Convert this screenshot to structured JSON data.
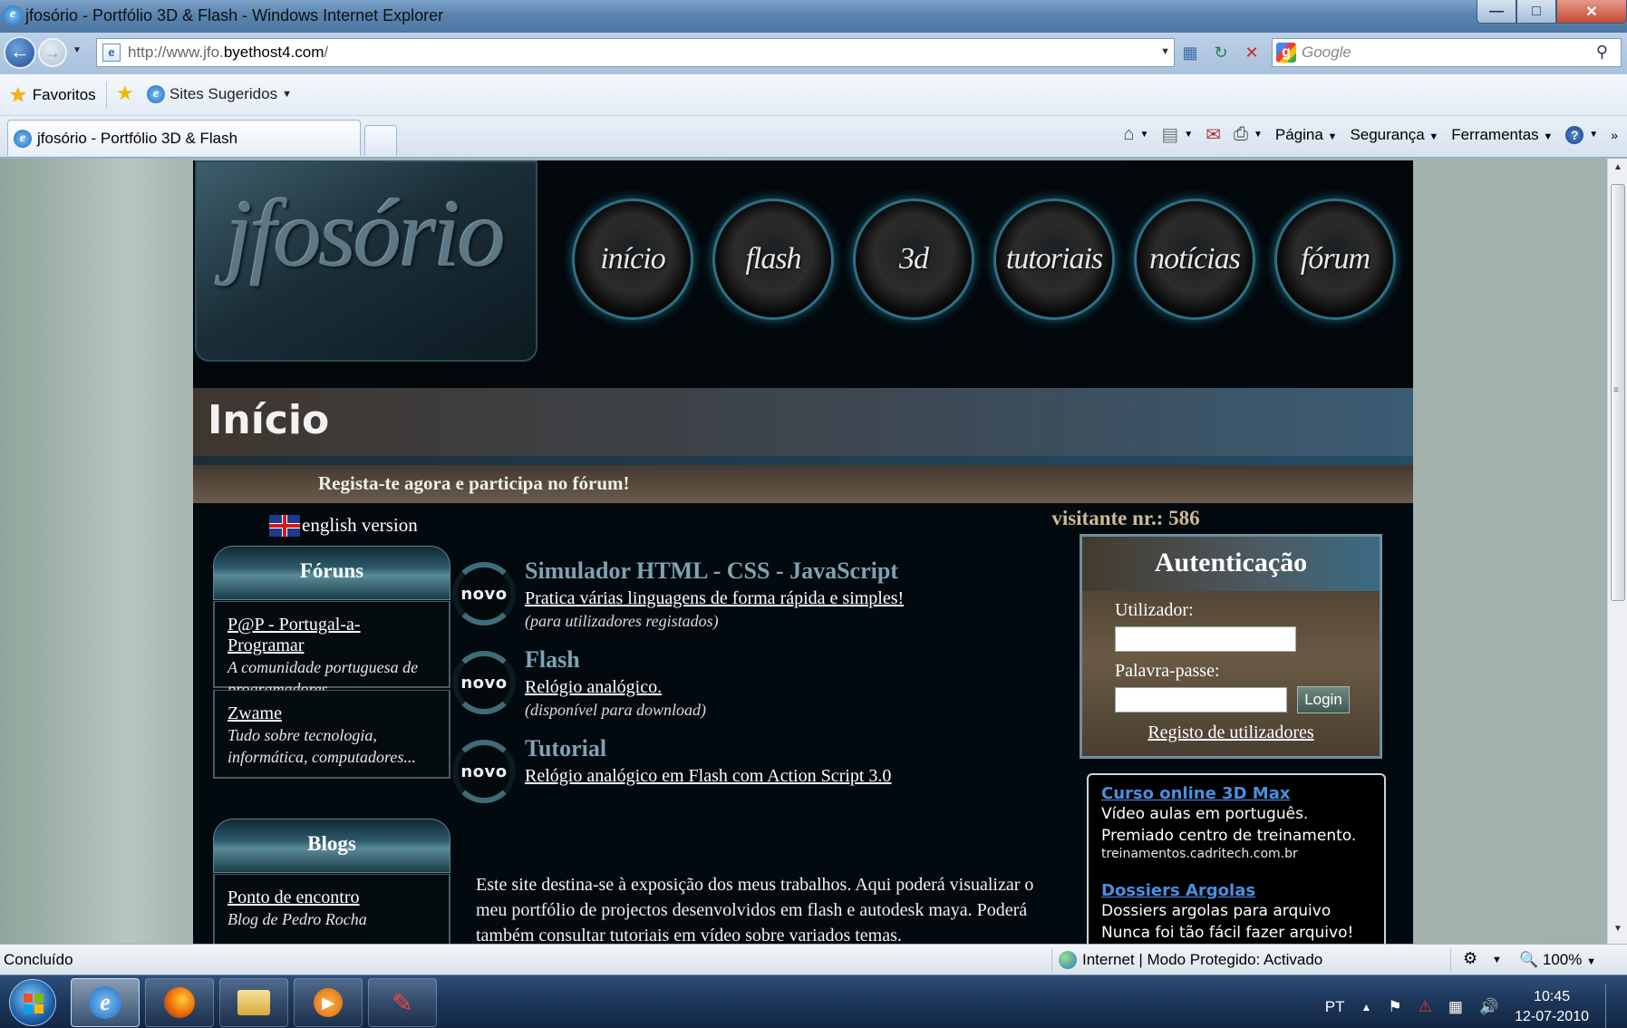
{
  "window": {
    "title": "jfosório - Portfólio 3D & Flash - Windows Internet Explorer",
    "minimize": "—",
    "maximize": "□",
    "close": "✕"
  },
  "address_bar": {
    "url_prefix": "http://www.jfo.",
    "url_domain": "byethost4.com",
    "url_suffix": "/",
    "search_placeholder": "Google"
  },
  "favorites_bar": {
    "favorites_label": "Favoritos",
    "suggested_sites_label": "Sites Sugeridos"
  },
  "tabs": {
    "active_tab_title": "jfosório - Portfólio 3D & Flash"
  },
  "command_bar": {
    "page_label": "Página",
    "security_label": "Segurança",
    "tools_label": "Ferramentas"
  },
  "site": {
    "logo_text": "jfosório",
    "nav": [
      {
        "label": "início"
      },
      {
        "label": "flash"
      },
      {
        "label": "3d"
      },
      {
        "label": "tutoriais"
      },
      {
        "label": "notícias"
      },
      {
        "label": "fórum"
      }
    ],
    "page_title": "Início",
    "register_banner": "Regista-te agora e participa no fórum!",
    "english_version": "english version",
    "forums": {
      "heading": "Fóruns",
      "items": [
        {
          "title": "P@P - Portugal-a-Programar",
          "desc": "A comunidade portuguesa de programadores"
        },
        {
          "title": "Zwame",
          "desc": "Tudo sobre tecnologia, informática, computadores..."
        }
      ]
    },
    "blogs": {
      "heading": "Blogs",
      "items": [
        {
          "title": "Ponto de encontro",
          "desc": "Blog de Pedro Rocha"
        }
      ]
    },
    "news_badge": "novo",
    "news": [
      {
        "title": "Simulador HTML - CSS - JavaScript",
        "link": "Pratica várias linguagens de forma rápida e simples!",
        "note": "(para utilizadores registados)"
      },
      {
        "title": "Flash",
        "link": "Relógio analógico.",
        "note": "(disponível para download)"
      },
      {
        "title": "Tutorial",
        "link": "Relógio analógico em Flash com Action Script 3.0",
        "note": ""
      }
    ],
    "intro_text": "Este site destina-se à exposição dos meus trabalhos. Aqui poderá visualizar o meu portfólio de projectos desenvolvidos em flash e autodesk maya. Poderá também consultar tutoriais em vídeo sobre variados temas.",
    "visitor_counter": "visitante nr.: 586",
    "auth": {
      "heading": "Autenticação",
      "user_label": "Utilizador:",
      "password_label": "Palavra-passe:",
      "login_button": "Login",
      "register_link": "Registo de utilizadores"
    },
    "ads": [
      {
        "title": "Curso online 3D Max",
        "text": "Vídeo aulas em português. Premiado centro de treinamento.",
        "url": "treinamentos.cadritech.com.br"
      },
      {
        "title": "Dossiers Argolas",
        "text": "Dossiers argolas para arquivo Nunca foi tão fácil fazer arquivo!",
        "url": ""
      }
    ]
  },
  "status_bar": {
    "status": "Concluído",
    "zone": "Internet | Modo Protegido: Activado",
    "zoom": "100%"
  },
  "taskbar": {
    "language": "PT",
    "time": "10:45",
    "date": "12-07-2010"
  }
}
